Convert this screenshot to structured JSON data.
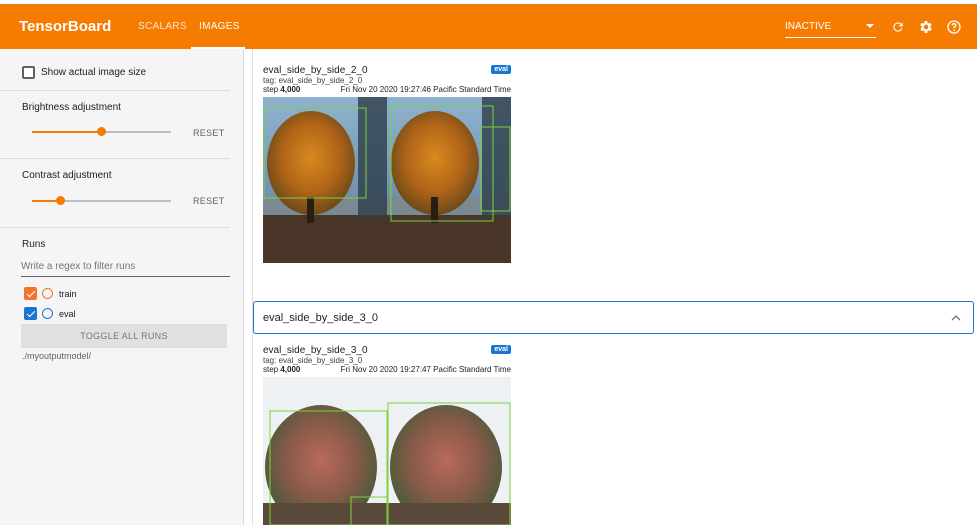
{
  "app": {
    "title": "TensorBoard"
  },
  "tabs": [
    {
      "label": "SCALARS"
    },
    {
      "label": "IMAGES"
    }
  ],
  "status": {
    "value": "INACTIVE"
  },
  "colors": {
    "accent": "#f57c00",
    "train": "#f4742f",
    "eval": "#1976d2"
  },
  "icons": {
    "refresh": "refresh-icon",
    "settings": "gear-icon",
    "help": "help-icon"
  },
  "sidebar": {
    "show_actual_size": "Show actual image size",
    "brightness": {
      "label": "Brightness adjustment",
      "reset": "RESET",
      "value_fraction": 0.5
    },
    "contrast": {
      "label": "Contrast adjustment",
      "reset": "RESET",
      "value_fraction": 0.2
    },
    "runs": {
      "title": "Runs",
      "filter_placeholder": "Write a regex to filter runs",
      "items": [
        {
          "name": "train",
          "checked": true
        },
        {
          "name": "eval",
          "checked": true
        }
      ],
      "toggle_all": "TOGGLE ALL RUNS",
      "logdir": "./myoutputmodel/"
    }
  },
  "main": {
    "cards": [
      {
        "title": "eval_side_by_side_2_0",
        "tag": "tag: eval_side_by_side_2_0",
        "step_label": "step",
        "step": "4,000",
        "time": "Fri Nov 20 2020 19:27:46 Pacific Standard Time",
        "badge": "eval"
      },
      {
        "title": "eval_side_by_side_3_0",
        "tag": "tag: eval_side_by_side_3_0",
        "step_label": "step",
        "step": "4,000",
        "time": "Fri Nov 20 2020 19:27:47 Pacific Standard Time",
        "badge": "eval"
      }
    ],
    "group": {
      "title": "eval_side_by_side_3_0"
    }
  }
}
